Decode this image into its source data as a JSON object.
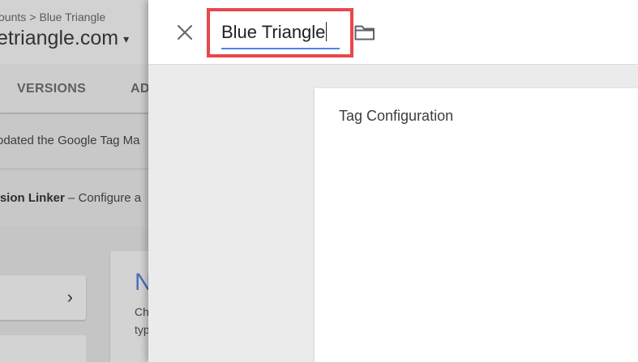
{
  "background": {
    "breadcrumb": {
      "parent": "ounts",
      "separator": ">",
      "current": "Blue Triangle"
    },
    "container_name": "etriangle.com",
    "container_caret": "▾",
    "tabs": {
      "versions": "VERSIONS",
      "admin": "AD"
    },
    "notice_text": "odated the Google Tag Ma",
    "linker": {
      "title": "rsion Linker",
      "dash": "–",
      "desc": "Configure a"
    },
    "card_right": {
      "heading": "N",
      "line1": "Ch",
      "line2": "typ"
    },
    "chevron": "›"
  },
  "panel": {
    "tag_name": "Blue Triangle",
    "tag_card": {
      "title": "Tag Configuration"
    },
    "highlight_color": "#e8474c",
    "underline_color": "#4a86e8"
  },
  "icons": {
    "close": "close-icon",
    "folder": "folder-icon",
    "chevron": "chevron-right-icon"
  }
}
